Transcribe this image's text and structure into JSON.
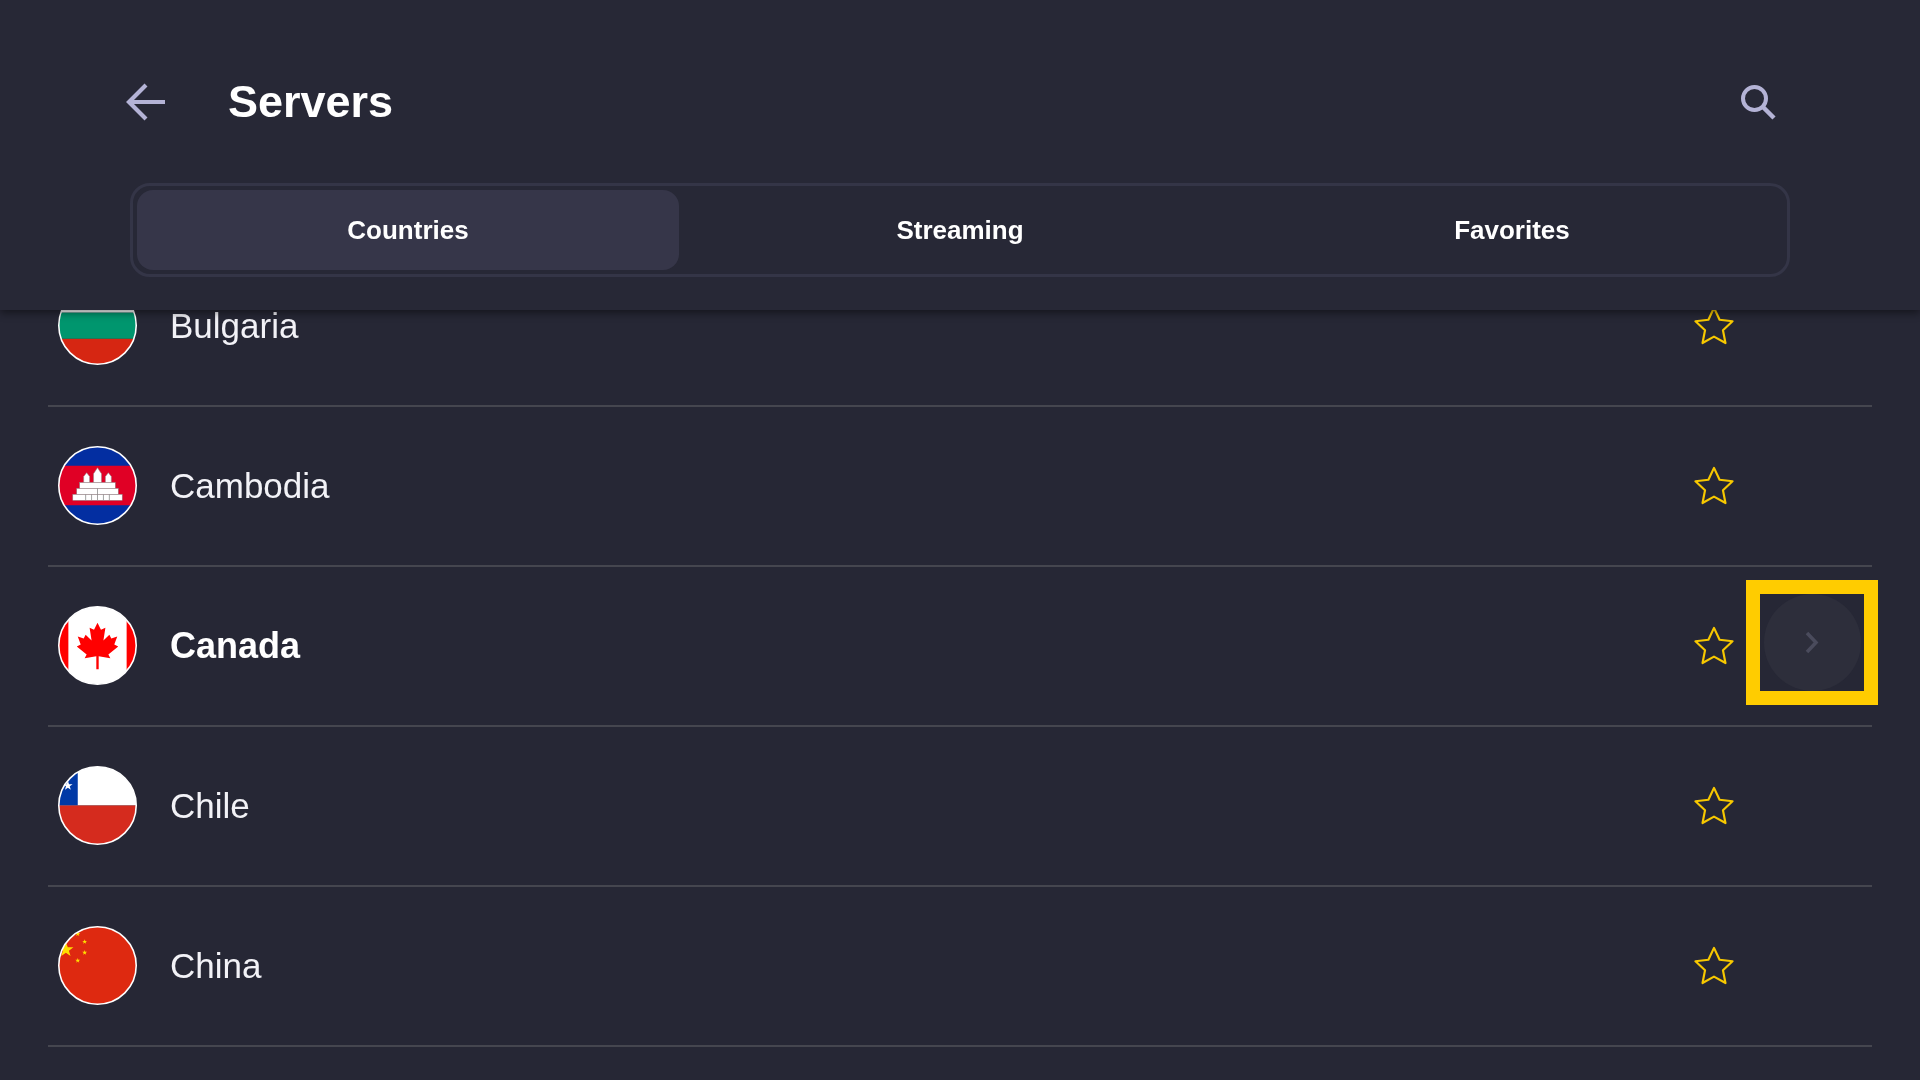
{
  "header": {
    "title": "Servers"
  },
  "tabs": [
    {
      "label": "Countries",
      "selected": true
    },
    {
      "label": "Streaming",
      "selected": false
    },
    {
      "label": "Favorites",
      "selected": false
    }
  ],
  "countries": [
    {
      "name": "Bulgaria",
      "kind": "bulgaria",
      "favorite": false,
      "selected": false,
      "highlighted": false
    },
    {
      "name": "Cambodia",
      "kind": "cambodia",
      "favorite": false,
      "selected": false,
      "highlighted": false
    },
    {
      "name": "Canada",
      "kind": "canada",
      "favorite": false,
      "selected": true,
      "highlighted": true
    },
    {
      "name": "Chile",
      "kind": "chile",
      "favorite": false,
      "selected": false,
      "highlighted": false
    },
    {
      "name": "China",
      "kind": "china",
      "favorite": false,
      "selected": false,
      "highlighted": false
    }
  ]
}
